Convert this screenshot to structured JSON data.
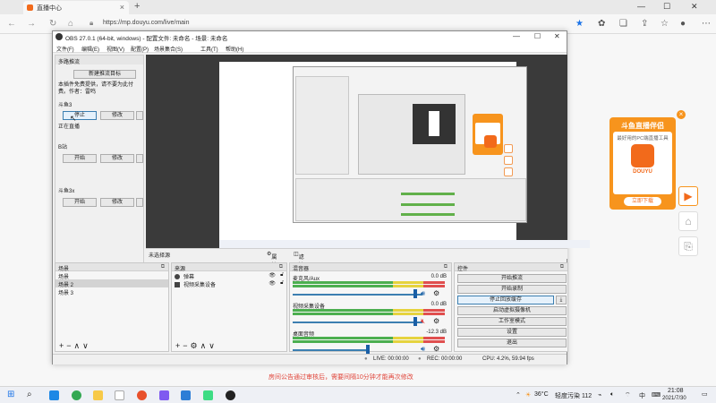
{
  "browser": {
    "tab_title": "直播中心",
    "url": "https://mp.douyu.com/live/main"
  },
  "obs": {
    "title": "OBS 27.0.1 (64-bit, windows) - 配置文件: 未命名 - 场景: 未命名",
    "menu": [
      "文件(F)",
      "编辑(E)",
      "视图(V)",
      "配置(P)",
      "场景集合(S)",
      "工具(T)",
      "帮助(H)"
    ],
    "multi_panel": {
      "title": "多路推流",
      "new_target": "新建推流目标",
      "note": "本插件免费提供，请不要为此付费。作者：雷鸣",
      "groups": [
        {
          "name": "斗鱼3",
          "btn1": "停止",
          "btn2": "修改",
          "status": "正在直播"
        },
        {
          "name": "B站",
          "btn1": "开始",
          "btn2": "修改",
          "status": ""
        },
        {
          "name": "斗鱼3x",
          "btn1": "开始",
          "btn2": "修改",
          "status": ""
        }
      ]
    },
    "preview_bar": {
      "source_label": "未选择源",
      "properties": "属性",
      "filters": "滤镜"
    },
    "scenes": {
      "title": "场景",
      "items": [
        "场景",
        "场景 2",
        "场景 3"
      ]
    },
    "sources": {
      "title": "来源",
      "items": [
        "弹幕",
        "视频采集设备"
      ]
    },
    "mixer": {
      "title": "混音器",
      "channels": [
        {
          "name": "麦克风/Aux",
          "db": "0.0 dB"
        },
        {
          "name": "视频采集设备",
          "db": "0.0 dB"
        },
        {
          "name": "桌面音频",
          "db": "-12.3 dB"
        }
      ]
    },
    "controls": {
      "title": "控件",
      "buttons": [
        "开始推流",
        "开始录制",
        "停止回放缓存",
        "启动虚拟摄像机",
        "工作室模式",
        "设置",
        "退出"
      ]
    },
    "status": {
      "live": "LIVE: 00:00:00",
      "rec": "REC: 00:00:00",
      "cpu": "CPU: 4.2%, 59.94 fps"
    }
  },
  "notice": "房间公告通过审核后，需要间隔10分钟才能再次修改",
  "ad": {
    "title": "斗鱼直播伴侣",
    "subtitle": "最好用的PC端直播工具",
    "brand": "DOUYU",
    "download": "立即下载"
  },
  "taskbar": {
    "weather_temp": "36°C",
    "weather_desc": "轻度污染 112",
    "ime": "中",
    "time": "21:08",
    "date": "2021/7/30"
  },
  "colors": {
    "accent": "#f7941d",
    "brand": "#f26a1b",
    "obs_select": "#3c7fb1",
    "notice": "#e0453a"
  }
}
